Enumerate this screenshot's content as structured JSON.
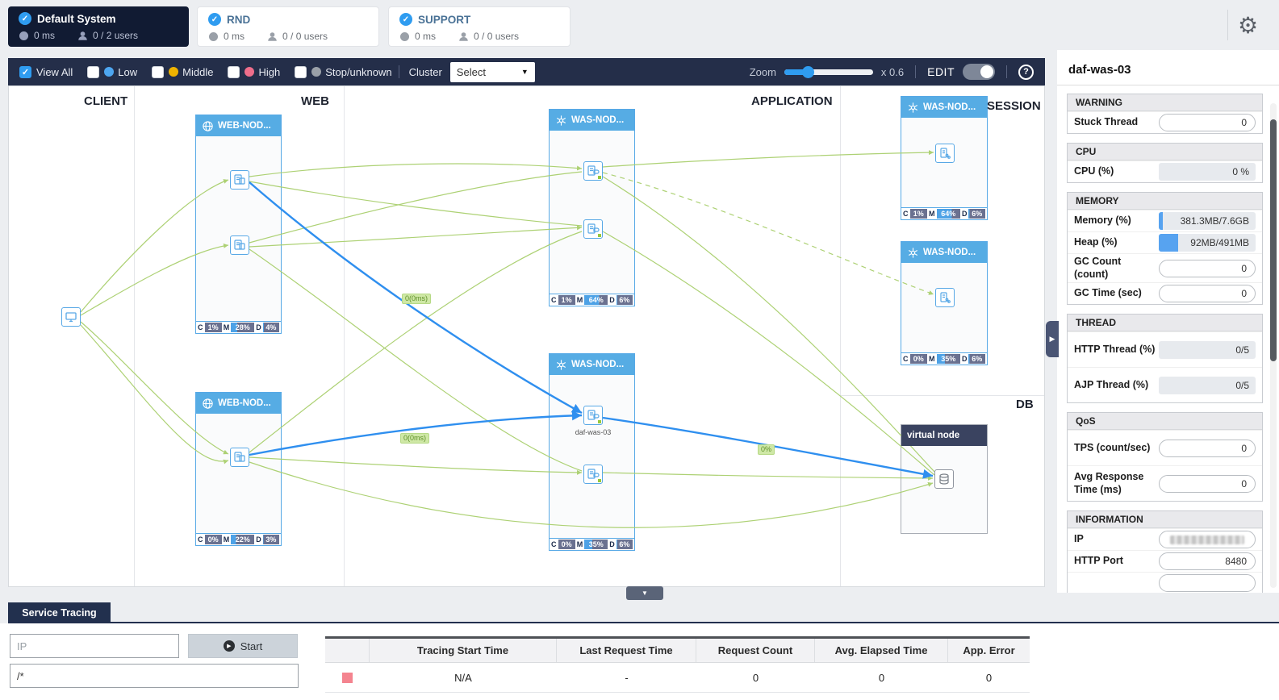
{
  "icons": {
    "check": "✓",
    "gear": "⚙",
    "select_chevron": "▼",
    "help": "?",
    "collapse_down": "▼",
    "panel_collapse": "▶",
    "start_play": "▶"
  },
  "header": {
    "cards": [
      {
        "title": "Default System",
        "response_time": "0 ms",
        "users": "0 / 2 users"
      },
      {
        "title": "RND",
        "response_time": "0 ms",
        "users": "0 / 0 users"
      },
      {
        "title": "SUPPORT",
        "response_time": "0 ms",
        "users": "0 / 0 users"
      }
    ]
  },
  "filter_bar": {
    "view_all_label": "View All",
    "levels": [
      {
        "label": "Low",
        "color": "#4da6f0"
      },
      {
        "label": "Middle",
        "color": "#f0b400"
      },
      {
        "label": "High",
        "color": "#ef6e8b"
      },
      {
        "label": "Stop/unknown",
        "color": "#9aa0a8"
      }
    ],
    "cluster_label": "Cluster",
    "select_value": "Select",
    "zoom_label": "Zoom",
    "zoom_value": "x 0.6",
    "edit_label": "EDIT"
  },
  "topology": {
    "column_labels": [
      "CLIENT",
      "WEB",
      "APPLICATION",
      "SESSION",
      "DB"
    ],
    "edge_labels": {
      "web1_to_app2": "0(0ms)",
      "web2_to_app2": "0(0ms)",
      "app2_to_db": "0%"
    },
    "nodes": {
      "web1": {
        "title": "WEB-NOD...",
        "stats": [
          {
            "k": "C",
            "v": "1%"
          },
          {
            "k": "M",
            "v": "28%"
          },
          {
            "k": "D",
            "v": "4%"
          }
        ]
      },
      "web2": {
        "title": "WEB-NOD...",
        "stats": [
          {
            "k": "C",
            "v": "0%"
          },
          {
            "k": "M",
            "v": "22%"
          },
          {
            "k": "D",
            "v": "3%"
          }
        ]
      },
      "app1": {
        "title": "WAS-NOD...",
        "stats": [
          {
            "k": "C",
            "v": "1%"
          },
          {
            "k": "M",
            "v": "64%"
          },
          {
            "k": "D",
            "v": "6%"
          }
        ]
      },
      "app2": {
        "title": "WAS-NOD...",
        "instance_label": "daf-was-03",
        "stats": [
          {
            "k": "C",
            "v": "0%"
          },
          {
            "k": "M",
            "v": "35%"
          },
          {
            "k": "D",
            "v": "6%"
          }
        ]
      },
      "session1": {
        "title": "WAS-NOD...",
        "stats": [
          {
            "k": "C",
            "v": "1%"
          },
          {
            "k": "M",
            "v": "64%"
          },
          {
            "k": "D",
            "v": "6%"
          }
        ]
      },
      "session2": {
        "title": "WAS-NOD...",
        "stats": [
          {
            "k": "C",
            "v": "0%"
          },
          {
            "k": "M",
            "v": "35%"
          },
          {
            "k": "D",
            "v": "6%"
          }
        ]
      },
      "db": {
        "title": "virtual node"
      }
    }
  },
  "detail_panel": {
    "title": "daf-was-03",
    "sections": [
      {
        "title": "WARNING",
        "rows": [
          {
            "label": "Stuck Thread",
            "value": "0"
          }
        ]
      },
      {
        "title": "CPU",
        "rows": [
          {
            "label": "CPU (%)",
            "value": "0 %",
            "fill": "0%"
          }
        ]
      },
      {
        "title": "MEMORY",
        "rows": [
          {
            "label": "Memory (%)",
            "value": "381.3MB/7.6GB",
            "fill": "4%"
          },
          {
            "label": "Heap (%)",
            "value": "92MB/491MB",
            "fill": "20%"
          },
          {
            "label": "GC Count (count)",
            "value": "0"
          },
          {
            "label": "GC Time (sec)",
            "value": "0"
          }
        ]
      },
      {
        "title": "THREAD",
        "rows": [
          {
            "label": "HTTP Thread (%)",
            "value": "0/5",
            "fill": "0%"
          },
          {
            "label": "AJP Thread (%)",
            "value": "0/5",
            "fill": "0%"
          }
        ]
      },
      {
        "title": "QoS",
        "rows": [
          {
            "label": "TPS (count/sec)",
            "value": "0"
          },
          {
            "label": "Avg Response Time (ms)",
            "value": "0"
          }
        ]
      },
      {
        "title": "INFORMATION",
        "rows": [
          {
            "label": "IP",
            "masked": true
          },
          {
            "label": "HTTP Port",
            "value": "8480"
          }
        ]
      }
    ]
  },
  "service_tracing": {
    "tab_label": "Service Tracing",
    "ip_placeholder": "IP",
    "url_value": "/*",
    "start_label": "Start",
    "table": {
      "columns": [
        "",
        "Tracing Start Time",
        "Last Request Time",
        "Request Count",
        "Avg. Elapsed Time",
        "App. Error"
      ],
      "row": {
        "status_color": "#f4848f",
        "tracing_start_time": "N/A",
        "last_request_time": "-",
        "request_count": "0",
        "avg_elapsed_time": "0",
        "app_error": "0"
      }
    }
  }
}
